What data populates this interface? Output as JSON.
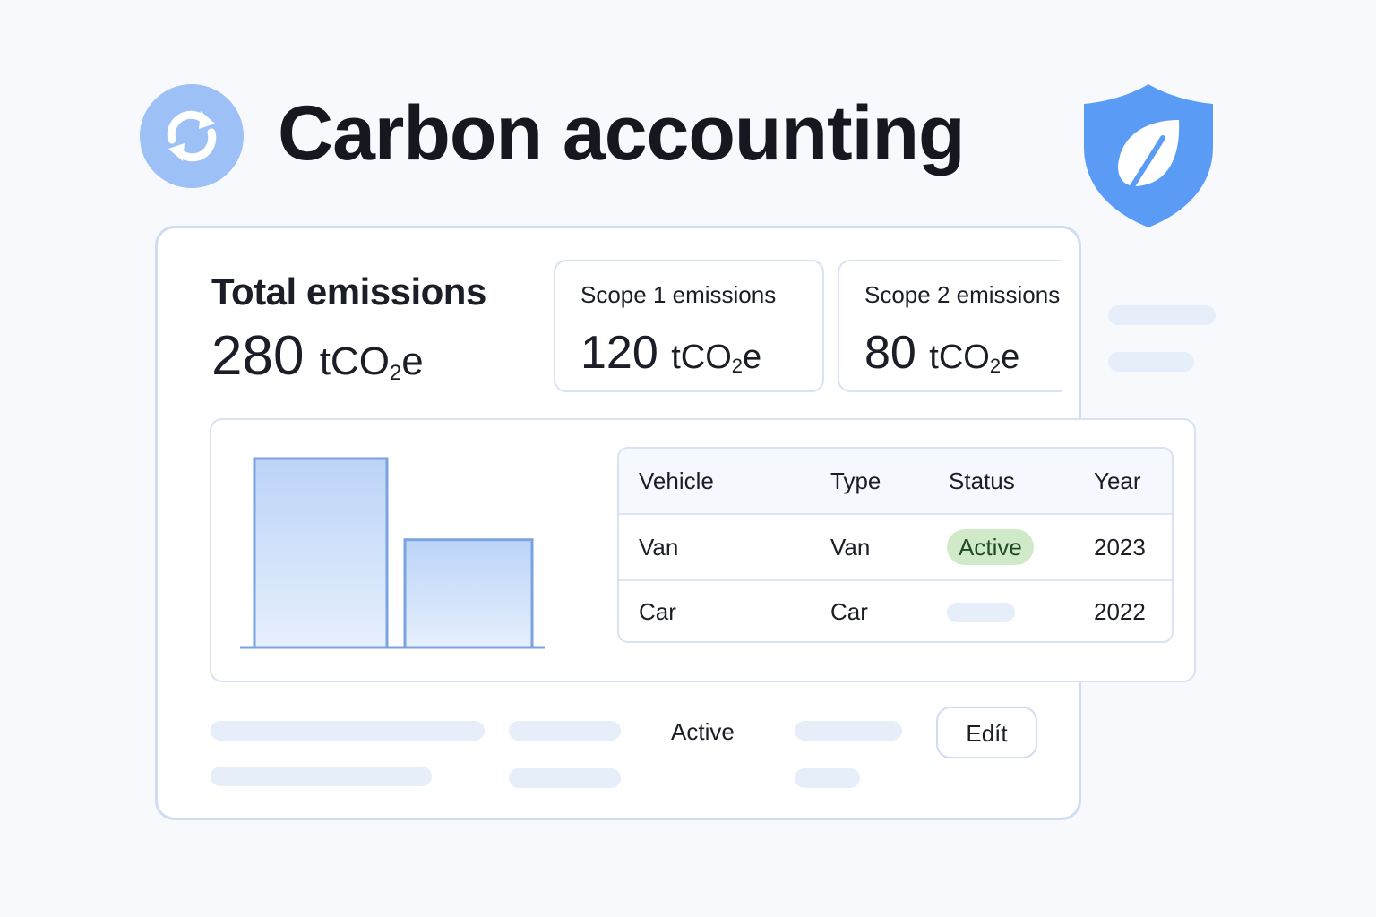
{
  "header": {
    "title": "Carbon accounting",
    "sync_icon": "sync-icon",
    "shield_icon": "shield-leaf-icon"
  },
  "summary": {
    "total": {
      "label": "Total emissions",
      "value": "280",
      "unit": "tCO",
      "unit_sub": "2",
      "unit_tail": "e"
    },
    "scope1": {
      "label": "Scope 1 emissions",
      "value": "120",
      "unit": "tCO",
      "unit_sub": "2",
      "unit_tail": "e"
    },
    "scope2": {
      "label": "Scope 2 emissions",
      "value": "80",
      "unit": "tCO",
      "unit_sub": "2",
      "unit_tail": "e"
    }
  },
  "chart_data": {
    "type": "bar",
    "categories": [
      "",
      ""
    ],
    "values": [
      100,
      57
    ],
    "title": "",
    "xlabel": "",
    "ylabel": "",
    "ylim": [
      0,
      100
    ]
  },
  "table": {
    "headers": [
      "Vehicle",
      "Type",
      "Status",
      "Year"
    ],
    "rows": [
      {
        "vehicle": "Van",
        "type": "Van",
        "status": "Active",
        "year": "2023"
      },
      {
        "vehicle": "Car",
        "type": "Car",
        "status": "",
        "year": "2022"
      }
    ]
  },
  "footer": {
    "status_text": "Active",
    "edit_label": "Edít"
  },
  "colors": {
    "accent": "#5a9cf5",
    "accent_light": "#9dc0f6",
    "active_pill": "#cfe9c9",
    "bar_fill": "#d6e5fb",
    "bar_stroke": "#7aa3e0"
  }
}
